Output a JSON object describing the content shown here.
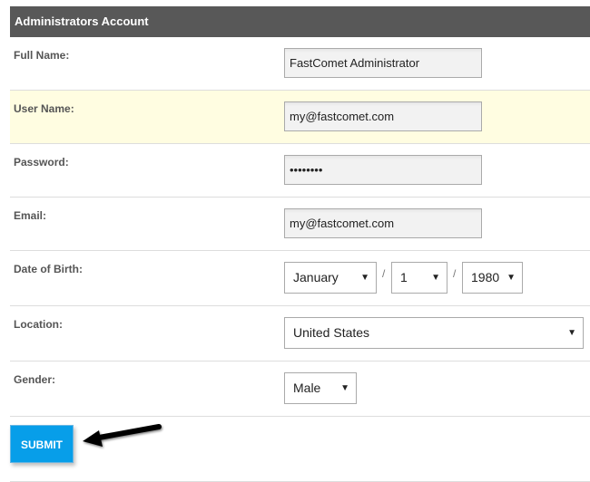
{
  "form": {
    "title": "Administrators Account",
    "fields": {
      "full_name": {
        "label": "Full Name:",
        "value": "FastComet Administrator"
      },
      "user_name": {
        "label": "User Name:",
        "value": "my@fastcomet.com"
      },
      "password": {
        "label": "Password:",
        "value": "••••••••"
      },
      "email": {
        "label": "Email:",
        "value": "my@fastcomet.com"
      },
      "dob": {
        "label": "Date of Birth:",
        "month": "January",
        "day": "1",
        "year": "1980",
        "separator": "/"
      },
      "location": {
        "label": "Location:",
        "value": "United States"
      },
      "gender": {
        "label": "Gender:",
        "value": "Male"
      }
    },
    "submit_label": "SUBMIT",
    "dropdown_glyph": "▼"
  },
  "colors": {
    "header_bg": "#585858",
    "highlight_row_bg": "#fffde1",
    "submit_bg": "#079ee9"
  }
}
